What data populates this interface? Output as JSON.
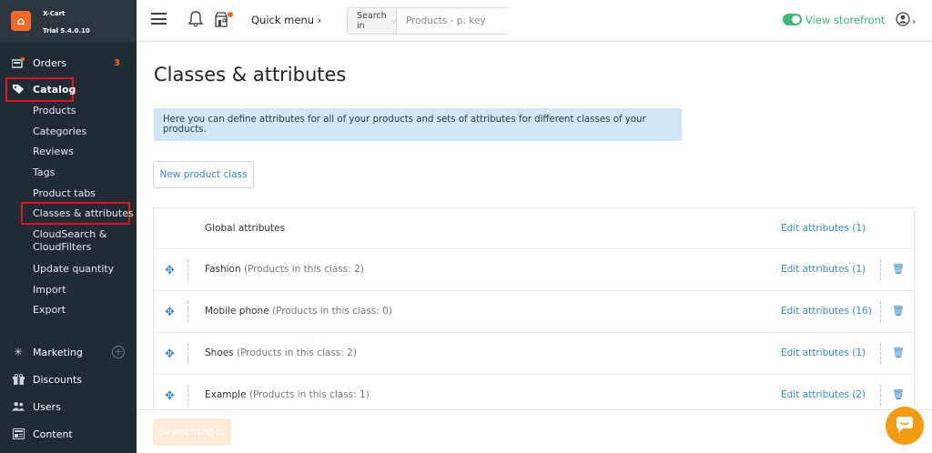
{
  "brand": {
    "name": "X-Cart",
    "version": "Trial 5.4.0.10"
  },
  "sidebar": {
    "orders": {
      "label": "Orders",
      "badge": "3"
    },
    "catalog": {
      "label": "Catalog"
    },
    "catalog_items": [
      "Products",
      "Categories",
      "Reviews",
      "Tags",
      "Product tabs",
      "Classes & attributes",
      "CloudSearch &",
      "CloudFilters",
      "Update quantity",
      "Import",
      "Export"
    ],
    "marketing": {
      "label": "Marketing"
    },
    "discounts": {
      "label": "Discounts"
    },
    "users": {
      "label": "Users"
    },
    "content": {
      "label": "Content"
    }
  },
  "topbar": {
    "quick_menu": "Quick menu ›",
    "search_in": "Search in",
    "search_placeholder": "Products - p: key",
    "view_storefront": "View storefront"
  },
  "main": {
    "title": "Classes & attributes",
    "info": "Here you can define attributes for all of your products and sets of attributes for different classes of your products.",
    "new_class_button": "New product class",
    "rows": [
      {
        "name": "Global attributes",
        "count": "",
        "edit": "Edit attributes (1)"
      },
      {
        "name": "Fashion",
        "count": "(Products in this class: 2)",
        "edit": "Edit attributes (1)"
      },
      {
        "name": "Mobile phone",
        "count": "(Products in this class: 0)",
        "edit": "Edit attributes (16)"
      },
      {
        "name": "Shoes",
        "count": "(Products in this class: 2)",
        "edit": "Edit attributes (1)"
      },
      {
        "name": "Example",
        "count": "(Products in this class: 1)",
        "edit": "Edit attributes (2)"
      }
    ],
    "save_button": "Save changes"
  },
  "colors": {
    "sidebar_bg": "#212b33",
    "accent_orange": "#f0692b",
    "link_blue": "#3a87c7",
    "storefront_green": "#3cb878",
    "highlight_red": "#e0141e",
    "info_bg": "#cfe6f8"
  }
}
